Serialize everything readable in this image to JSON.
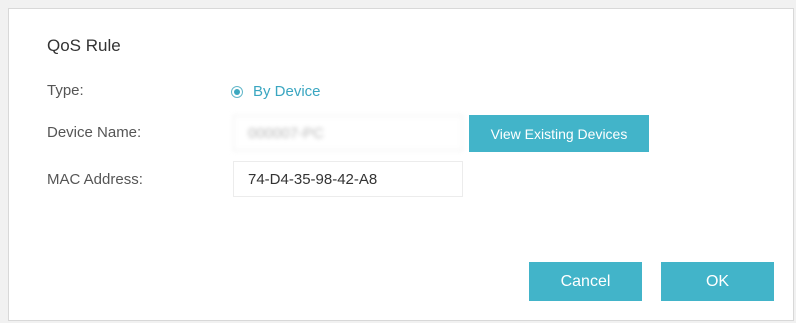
{
  "dialog": {
    "title": "QoS Rule",
    "type_label": "Type:",
    "type_option": "By Device",
    "device_name_label": "Device Name:",
    "device_name_value": "000007-PC",
    "mac_address_label": "MAC Address:",
    "mac_address_value": "74-D4-35-98-42-A8",
    "view_devices_button": "View Existing Devices",
    "cancel_button": "Cancel",
    "ok_button": "OK"
  },
  "colors": {
    "accent": "#42b4c9",
    "link_text": "#3aa6c1"
  }
}
